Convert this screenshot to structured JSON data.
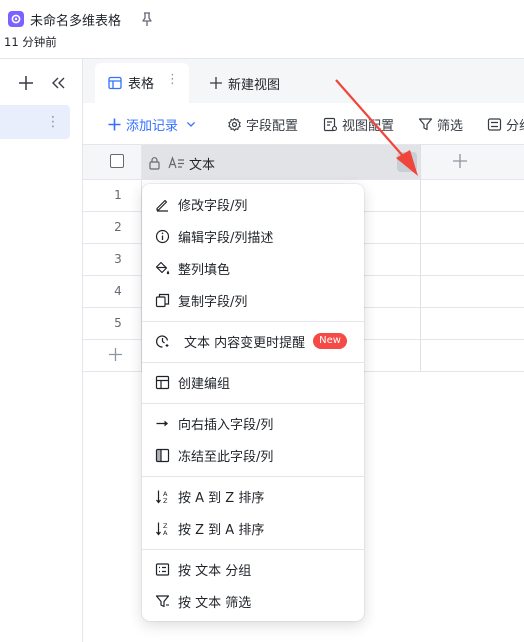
{
  "document": {
    "title": "未命名多维表格",
    "updated": "11 分钟前"
  },
  "view_tabs": {
    "active_label": "表格",
    "new_view_label": "新建视图"
  },
  "toolbar": {
    "add_record": "添加记录",
    "field_config": "字段配置",
    "view_config": "视图配置",
    "filter": "筛选",
    "group": "分组"
  },
  "grid": {
    "field_name": "文本",
    "rows": [
      {
        "num": "1"
      },
      {
        "num": "2"
      },
      {
        "num": "3"
      },
      {
        "num": "4"
      },
      {
        "num": "5"
      }
    ]
  },
  "context_menu": {
    "items": [
      {
        "icon": "edit-icon",
        "label": "修改字段/列"
      },
      {
        "icon": "info-icon",
        "label": "编辑字段/列描述"
      },
      {
        "icon": "fill-color-icon",
        "label": "整列填色"
      },
      {
        "icon": "copy-icon",
        "label": "复制字段/列"
      },
      {
        "icon": "reminder-icon",
        "label": "文本 内容变更时提醒",
        "badge": "New"
      },
      {
        "icon": "group-layout-icon",
        "label": "创建编组"
      },
      {
        "icon": "arrow-right-icon",
        "label": "向右插入字段/列"
      },
      {
        "icon": "freeze-icon",
        "label": "冻结至此字段/列"
      },
      {
        "icon": "sort-asc-icon",
        "label": "按 A 到 Z 排序"
      },
      {
        "icon": "sort-desc-icon",
        "label": "按 Z 到 A 排序"
      },
      {
        "icon": "group-by-icon",
        "label": "按 文本 分组"
      },
      {
        "icon": "filter-icon",
        "label": "按 文本 筛选"
      }
    ]
  },
  "colors": {
    "accent": "#3370ff",
    "arrow": "#f0453a",
    "badge": "#f54a45",
    "doc_icon": "#7b61ff"
  }
}
